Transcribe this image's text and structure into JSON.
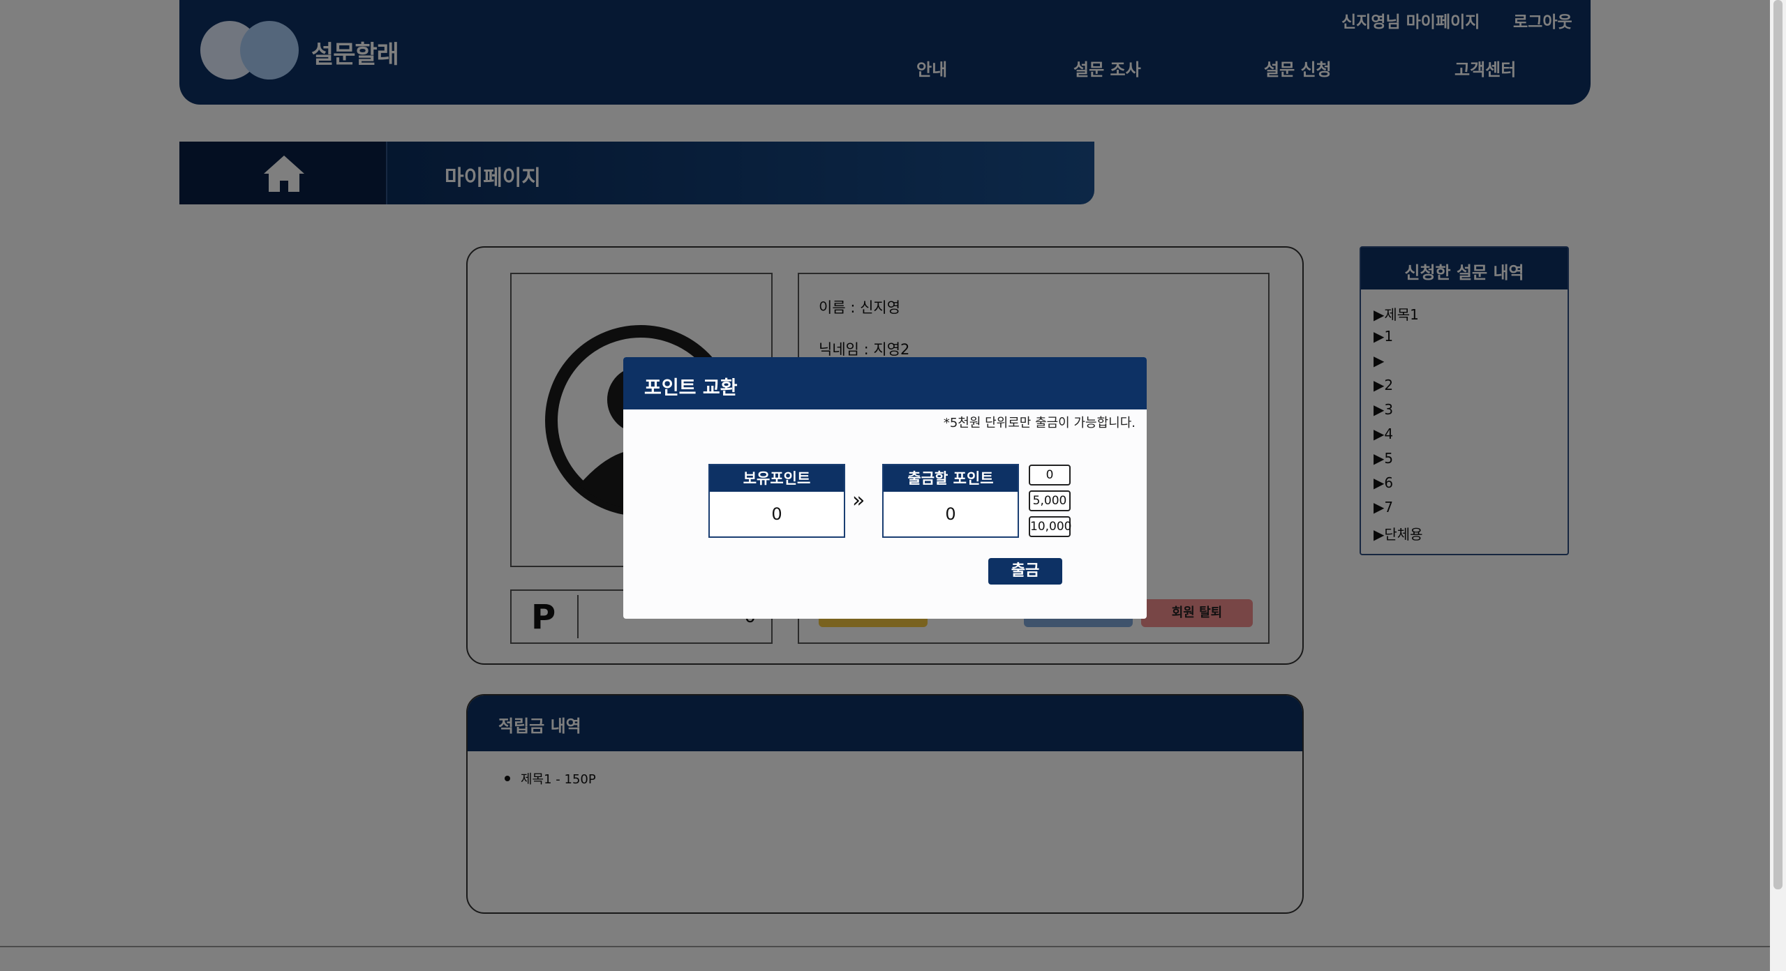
{
  "header": {
    "logo_text": "설문할래",
    "user_link": "신지영님 마이페이지",
    "logout": "로그아웃",
    "nav": [
      "안내",
      "설문 조사",
      "설문 신청",
      "고객센터"
    ]
  },
  "breadcrumb": {
    "title": "마이페이지"
  },
  "profile": {
    "name_line": "이름 : 신지영",
    "nickname_line": "닉네임 : 지영2",
    "points_symbol": "P",
    "points_value": "0",
    "withdraw_member": "회원 탈퇴"
  },
  "sidebar": {
    "title": "신청한 설문 내역",
    "items": [
      "▶제목1",
      "▶1",
      "▶",
      "▶2",
      "▶3",
      "▶4",
      "▶5",
      "▶6",
      "▶7",
      "▶단체용"
    ]
  },
  "history": {
    "title": "적립금 내역",
    "items": [
      "제목1 - 150P"
    ]
  },
  "modal": {
    "title": "포인트 교환",
    "note": "*5천원 단위로만 출금이 가능합니다.",
    "have_label": "보유포인트",
    "have_value": "0",
    "withdraw_label": "출금할 포인트",
    "withdraw_value": "0",
    "amounts": [
      "0",
      "5,000",
      "10,000"
    ],
    "submit": "출금"
  },
  "colors": {
    "primary": "#0d3164",
    "overlay": "rgba(0,0,0,0.5)",
    "withdraw_red": "#f08d8d"
  }
}
